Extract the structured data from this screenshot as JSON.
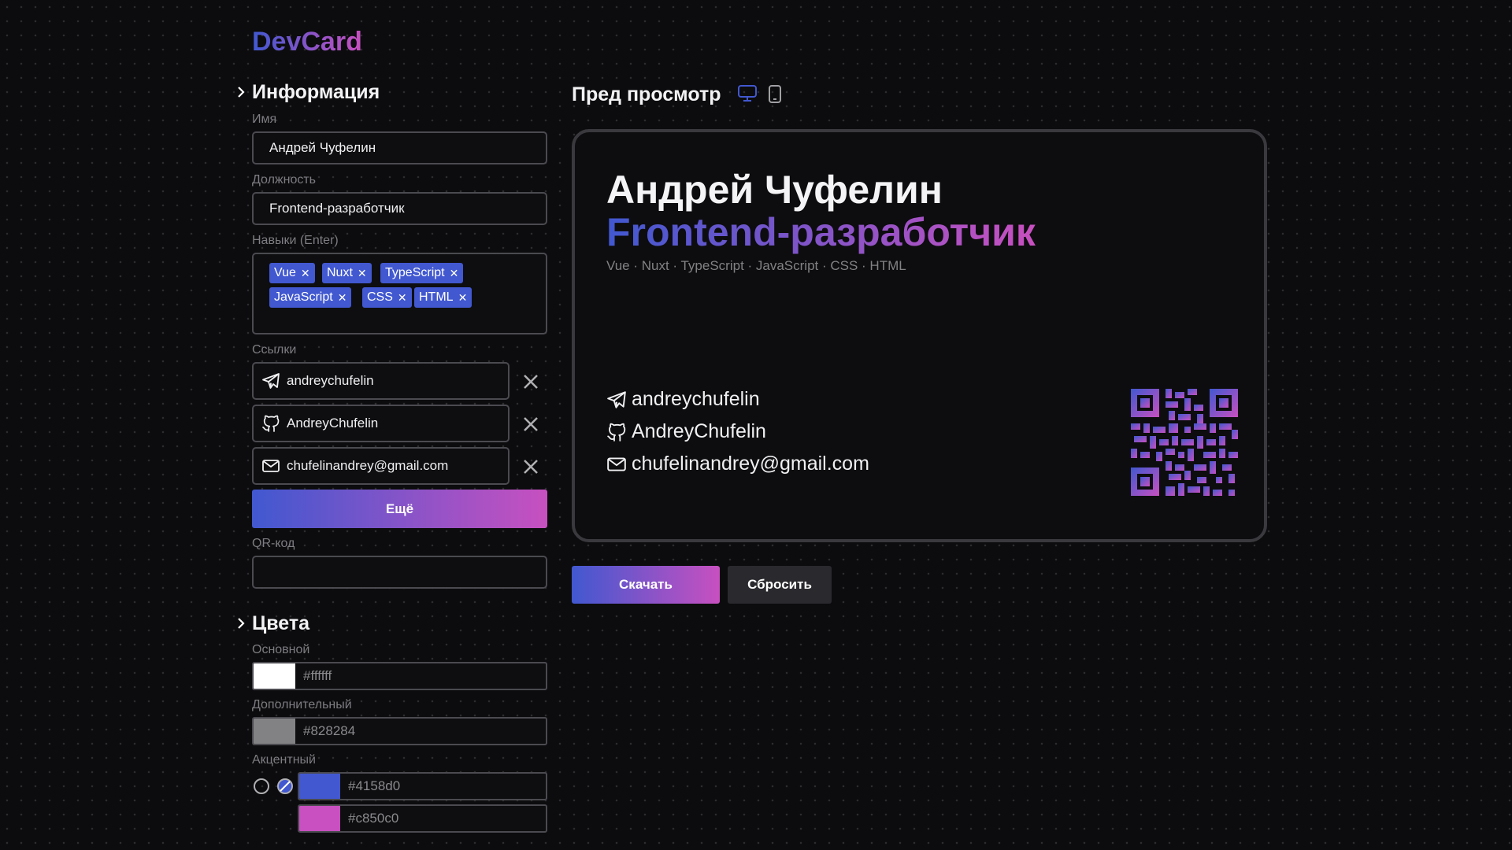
{
  "app": {
    "logo": "DevCard"
  },
  "info": {
    "title": "Информация",
    "name_label": "Имя",
    "name_value": "Андрей Чуфелин",
    "role_label": "Должность",
    "role_value": "Frontend-разработчик",
    "skills_label": "Навыки (Enter)",
    "skills": [
      "Vue",
      "Nuxt",
      "TypeScript",
      "JavaScript",
      "CSS",
      "HTML"
    ],
    "links_label": "Ссылки",
    "links": [
      {
        "icon": "telegram-icon",
        "value": "andreychufelin"
      },
      {
        "icon": "github-icon",
        "value": "AndreyChufelin"
      },
      {
        "icon": "mail-icon",
        "value": "chufelinandrey@gmail.com"
      }
    ],
    "more_button": "Ещё",
    "qr_label": "QR-код",
    "qr_value": ""
  },
  "colors": {
    "title": "Цвета",
    "primary_label": "Основной",
    "primary_value": "#ffffff",
    "secondary_label": "Дополнительный",
    "secondary_value": "#828284",
    "accent_label": "Акцентный",
    "accent_value_1": "#4158d0",
    "accent_value_2": "#c850c0"
  },
  "preview": {
    "title": "Пред просмотр",
    "icons": [
      "monitor-icon",
      "phone-icon"
    ],
    "card": {
      "name": "Андрей Чуфелин",
      "role": "Frontend-разработчик",
      "skills_line": "Vue · Nuxt · TypeScript · JavaScript · CSS · HTML",
      "links": [
        "andreychufelin",
        "AndreyChufelin",
        "chufelinandrey@gmail.com"
      ]
    }
  },
  "actions": {
    "download": "Скачать",
    "reset": "Сбросить"
  }
}
